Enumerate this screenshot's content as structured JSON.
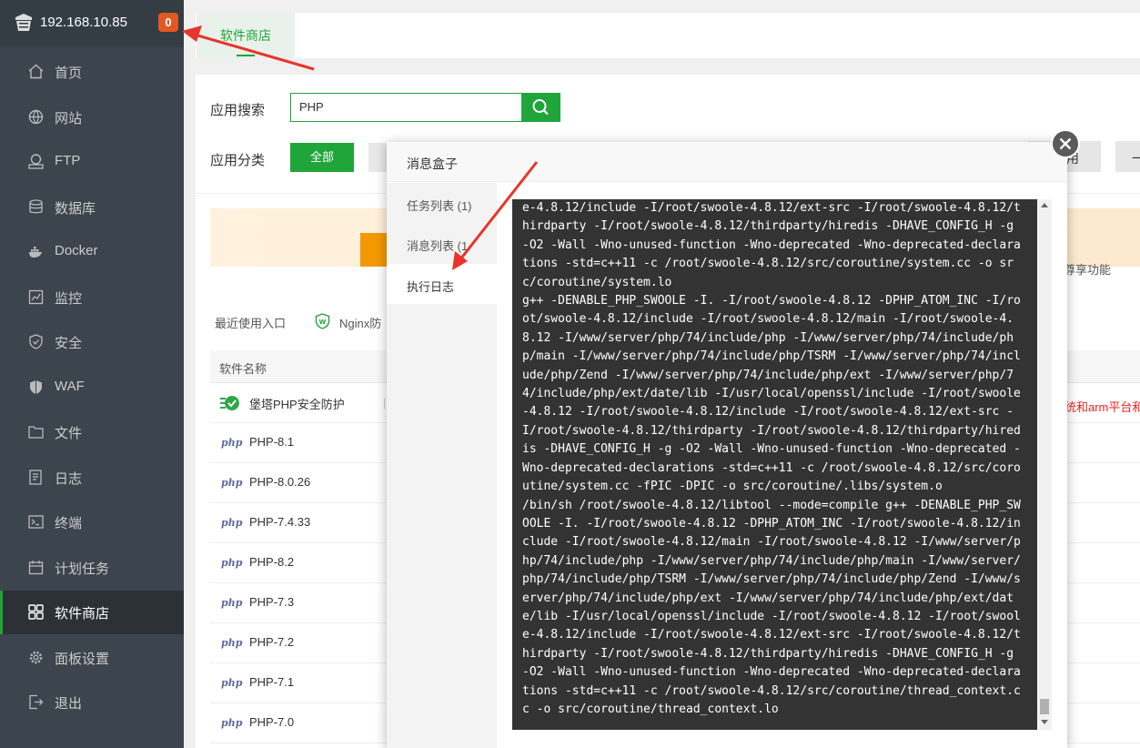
{
  "sidebar": {
    "server_ip": "192.168.10.85",
    "badge": "0",
    "items": [
      {
        "label": "首页"
      },
      {
        "label": "网站"
      },
      {
        "label": "FTP"
      },
      {
        "label": "数据库"
      },
      {
        "label": "Docker"
      },
      {
        "label": "监控"
      },
      {
        "label": "安全"
      },
      {
        "label": "WAF"
      },
      {
        "label": "文件"
      },
      {
        "label": "日志"
      },
      {
        "label": "终端"
      },
      {
        "label": "计划任务"
      },
      {
        "label": "软件商店"
      },
      {
        "label": "面板设置"
      },
      {
        "label": "退出"
      }
    ],
    "active_item": "软件商店"
  },
  "main": {
    "tab": "软件商店",
    "search_label": "应用搜索",
    "search_value": "PHP",
    "category_label": "应用分类",
    "category_all": "全部",
    "right_text_fragment": "用",
    "right_btn_fragment": "一",
    "banner_tail": "尊享功能",
    "recent_label": "最近使用入口",
    "recent_app": "Nginx防",
    "table_header": "软件名称",
    "rows": [
      {
        "name": "堡塔PHP安全防护",
        "icon": "bt-shield-icon"
      },
      {
        "name": "PHP-8.1",
        "icon": "php-icon"
      },
      {
        "name": "PHP-8.0.26",
        "icon": "php-icon"
      },
      {
        "name": "PHP-7.4.33",
        "icon": "php-icon"
      },
      {
        "name": "PHP-8.2",
        "icon": "php-icon"
      },
      {
        "name": "PHP-7.3",
        "icon": "php-icon"
      },
      {
        "name": "PHP-7.2",
        "icon": "php-icon"
      },
      {
        "name": "PHP-7.1",
        "icon": "php-icon"
      },
      {
        "name": "PHP-7.0",
        "icon": "php-icon"
      }
    ],
    "php_icon_text": "php",
    "red_note": "统和arm平台和"
  },
  "modal": {
    "title": "消息盒子",
    "tabs": [
      {
        "label": "任务列表 (1)"
      },
      {
        "label": "消息列表 (1"
      },
      {
        "label": "执行日志"
      }
    ],
    "active_tab": "执行日志",
    "log_lines": [
      "e-4.8.12/include -I/root/swoole-4.8.12/ext-src -I/root/swoole-4.8.12/t",
      "hirdparty -I/root/swoole-4.8.12/thirdparty/hiredis -DHAVE_CONFIG_H -g",
      "-O2 -Wall -Wno-unused-function -Wno-deprecated -Wno-deprecated-declara",
      "tions -std=c++11 -c /root/swoole-4.8.12/src/coroutine/system.cc -o sr",
      "c/coroutine/system.lo",
      "g++ -DENABLE_PHP_SWOOLE -I. -I/root/swoole-4.8.12 -DPHP_ATOM_INC -I/ro",
      "ot/swoole-4.8.12/include -I/root/swoole-4.8.12/main -I/root/swoole-4.",
      "8.12 -I/www/server/php/74/include/php -I/www/server/php/74/include/ph",
      "p/main -I/www/server/php/74/include/php/TSRM -I/www/server/php/74/incl",
      "ude/php/Zend -I/www/server/php/74/include/php/ext -I/www/server/php/7",
      "4/include/php/ext/date/lib -I/usr/local/openssl/include -I/root/swoole",
      "-4.8.12 -I/root/swoole-4.8.12/include -I/root/swoole-4.8.12/ext-src -",
      "I/root/swoole-4.8.12/thirdparty -I/root/swoole-4.8.12/thirdparty/hired",
      "is -DHAVE_CONFIG_H -g -O2 -Wall -Wno-unused-function -Wno-deprecated -",
      "Wno-deprecated-declarations -std=c++11 -c /root/swoole-4.8.12/src/coro",
      "utine/system.cc -fPIC -DPIC -o src/coroutine/.libs/system.o",
      "/bin/sh /root/swoole-4.8.12/libtool --mode=compile g++ -DENABLE_PHP_SW",
      "OOLE -I. -I/root/swoole-4.8.12 -DPHP_ATOM_INC -I/root/swoole-4.8.12/in",
      "clude -I/root/swoole-4.8.12/main -I/root/swoole-4.8.12 -I/www/server/p",
      "hp/74/include/php -I/www/server/php/74/include/php/main -I/www/server/",
      "php/74/include/php/TSRM -I/www/server/php/74/include/php/Zend -I/www/s",
      "erver/php/74/include/php/ext -I/www/server/php/74/include/php/ext/dat",
      "e/lib -I/usr/local/openssl/include -I/root/swoole-4.8.12 -I/root/swool",
      "e-4.8.12/include -I/root/swoole-4.8.12/ext-src -I/root/swoole-4.8.12/t",
      "hirdparty -I/root/swoole-4.8.12/thirdparty/hiredis -DHAVE_CONFIG_H -g",
      "-O2 -Wall -Wno-unused-function -Wno-deprecated -Wno-deprecated-declara",
      "tions -std=c++11 -c /root/swoole-4.8.12/src/coroutine/thread_context.c",
      "c -o src/coroutine/thread_context.lo"
    ]
  },
  "colors": {
    "accent": "#20a53a",
    "sidebar_bg": "#3c444d",
    "badge": "#e25822",
    "annotation_arrow": "#e8352b"
  }
}
